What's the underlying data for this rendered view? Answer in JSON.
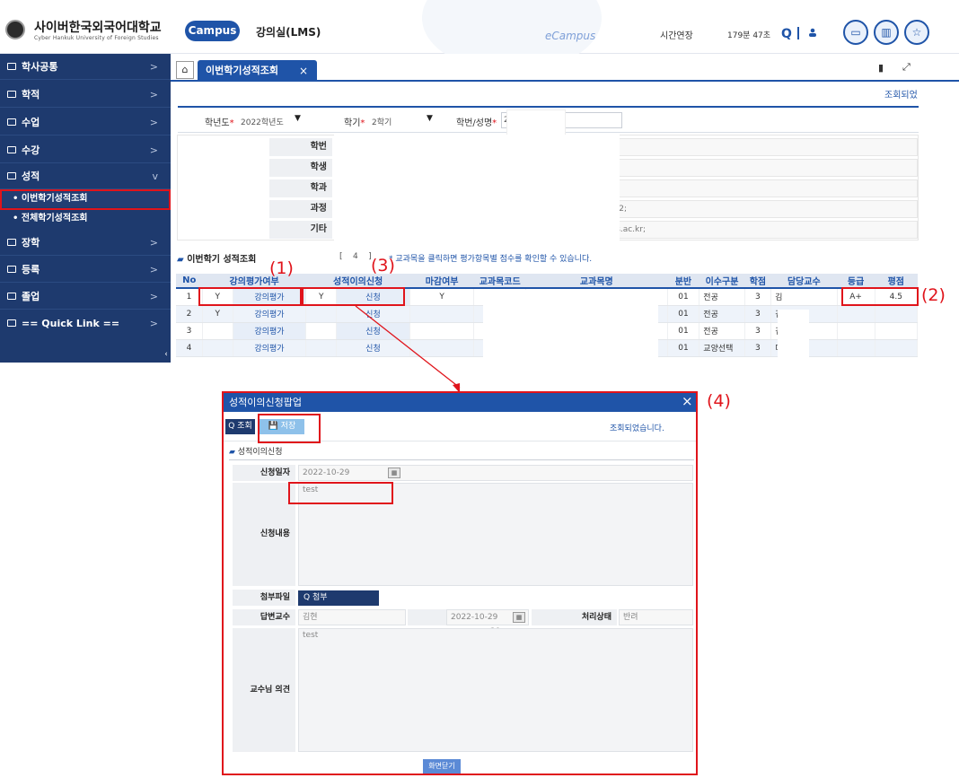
{
  "logo": {
    "title": "사이버한국외국어대학교",
    "subtitle": "Cyber Hankuk University of Foreign Studies"
  },
  "header": {
    "campus_label": "Campus",
    "app_title": "강의실(LMS)",
    "watermark": "eCampus",
    "time_extend": "시간연장",
    "time_left": "179분 47초"
  },
  "sidebar": {
    "items": [
      {
        "label": "학사공통",
        "chevron": ">"
      },
      {
        "label": "학적",
        "chevron": ">"
      },
      {
        "label": "수업",
        "chevron": ">"
      },
      {
        "label": "수강",
        "chevron": ">"
      },
      {
        "label": "성적",
        "chevron": "v"
      },
      {
        "label": "장학",
        "chevron": ">"
      },
      {
        "label": "등록",
        "chevron": ">"
      },
      {
        "label": "졸업",
        "chevron": ">"
      },
      {
        "label": "== Quick Link ==",
        "chevron": ">"
      }
    ],
    "subitems": [
      {
        "label": "• 이번학기성적조회"
      },
      {
        "label": "• 전체학기성적조회"
      }
    ],
    "collapse": "‹"
  },
  "tabs": {
    "home": "⌂",
    "active_label": "이번학기성적조회",
    "close": "×"
  },
  "status": {
    "retrieved": "조회되었"
  },
  "filters": {
    "year_label": "학년도",
    "year_value": "2022학년도",
    "term_label": "학기",
    "term_value": "2학기",
    "student_label": "학번/성명",
    "student_value": "2",
    "required_mark": "*",
    "dropdown": "▼"
  },
  "info": {
    "labels": [
      "학번",
      "학생",
      "학과",
      "과정",
      "기타"
    ],
    "values": [
      "",
      "",
      "",
      "기:2;",
      "fs.ac.kr;"
    ]
  },
  "grades": {
    "title": "이번학기 성적조회",
    "title_mark": "▰",
    "count_open": "[",
    "count": "4",
    "count_close": "]",
    "hint": "* 교과목을 클릭하면 평가항목별 점수를 확인할 수 있습니다.",
    "columns": [
      "No",
      "강의평가여부",
      "",
      "성적이의신청",
      "",
      "마감여부",
      "교과목코드",
      "교과목명",
      "분반",
      "이수구분",
      "학점",
      "담당교수",
      "등급",
      "평점"
    ],
    "rows": [
      {
        "no": "1",
        "eval_yn": "Y",
        "eval_link": "강의평가",
        "appeal_yn": "Y",
        "appeal_link": "신청",
        "closed": "Y",
        "code": "",
        "name": "",
        "section": "01",
        "type": "전공",
        "credit": "3",
        "prof": "김",
        "grade": "A+",
        "point": "4.5"
      },
      {
        "no": "2",
        "eval_yn": "Y",
        "eval_link": "강의평가",
        "appeal_yn": "",
        "appeal_link": "신청",
        "closed": "",
        "code": "",
        "name": "",
        "section": "01",
        "type": "전공",
        "credit": "3",
        "prof": "김",
        "grade": "",
        "point": ""
      },
      {
        "no": "3",
        "eval_yn": "",
        "eval_link": "강의평가",
        "appeal_yn": "",
        "appeal_link": "신청",
        "closed": "",
        "code": "",
        "name": "",
        "section": "01",
        "type": "전공",
        "credit": "3",
        "prof": "김",
        "grade": "",
        "point": ""
      },
      {
        "no": "4",
        "eval_yn": "",
        "eval_link": "강의평가",
        "appeal_yn": "",
        "appeal_link": "신청",
        "closed": "",
        "code": "s",
        "name": "",
        "section": "01",
        "type": "교양선택",
        "credit": "3",
        "prof": "미",
        "grade": "",
        "point": ""
      }
    ]
  },
  "annotations": {
    "m1": "(1)",
    "m2": "(2)",
    "m3": "(3)",
    "m4": "(4)"
  },
  "popup": {
    "title": "성적이의신청팝업",
    "close": "×",
    "search_btn": "Q 조회",
    "save_btn": "💾 저장",
    "message": "조회되었습니다.",
    "section_title": "성적이의신청",
    "section_mark": "▰",
    "apply_date_label": "신청일자",
    "apply_date": "2022-10-29",
    "content_label": "신청내용",
    "content": "test",
    "attach_label": "첨부파일",
    "attach_btn": "Q 첨부",
    "answer_prof_label": "답변교수",
    "answer_prof": "김현",
    "process_date_label": "처리일자",
    "process_date": "2022-10-29",
    "process_status_label": "처리상태",
    "process_status": "반려",
    "opinion_label": "교수님 의견",
    "opinion": "test",
    "close_btn": "화면닫기"
  },
  "colors": {
    "navy": "#1e3a6e",
    "brand": "#1f54a8",
    "highlight": "#e0141b"
  }
}
